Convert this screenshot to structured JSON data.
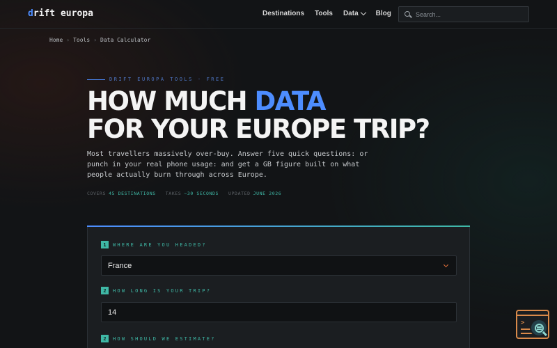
{
  "brand": {
    "logo_first": "d",
    "logo_rest": "rift europa"
  },
  "nav": {
    "items": [
      "Destinations",
      "Tools",
      "Data",
      "Blog"
    ]
  },
  "search": {
    "placeholder": "Search..."
  },
  "breadcrumb": [
    "Home",
    "Tools",
    "Data Calculator"
  ],
  "hero": {
    "eyebrow_left": "DRIFT EUROPA TOOLS",
    "eyebrow_right": "FREE",
    "title_line1_pre": "HOW MUCH ",
    "title_line1_accent": "DATA",
    "title_line2": "FOR YOUR EUROPE TRIP?",
    "lede": "Most travellers massively over-buy. Answer five quick questions: or punch in your real phone usage: and get a GB figure built on what people actually burn through across Europe.",
    "meta": [
      {
        "key": "COVERS",
        "value": "45 DESTINATIONS"
      },
      {
        "key": "TAKES",
        "value": "~30 SECONDS"
      },
      {
        "key": "UPDATED",
        "value": "JUNE 2026"
      }
    ]
  },
  "form": {
    "q1": {
      "num": "1",
      "label": "WHERE ARE YOU HEADED?",
      "value": "France"
    },
    "q2": {
      "num": "2",
      "label": "HOW LONG IS YOUR TRIP?",
      "value": "14"
    },
    "q3": {
      "num": "2",
      "label": "HOW SHOULD WE ESTIMATE?"
    }
  },
  "colors": {
    "accent_blue": "#4d8dff",
    "accent_teal": "#3fb8a6",
    "accent_orange": "#e0703a"
  }
}
